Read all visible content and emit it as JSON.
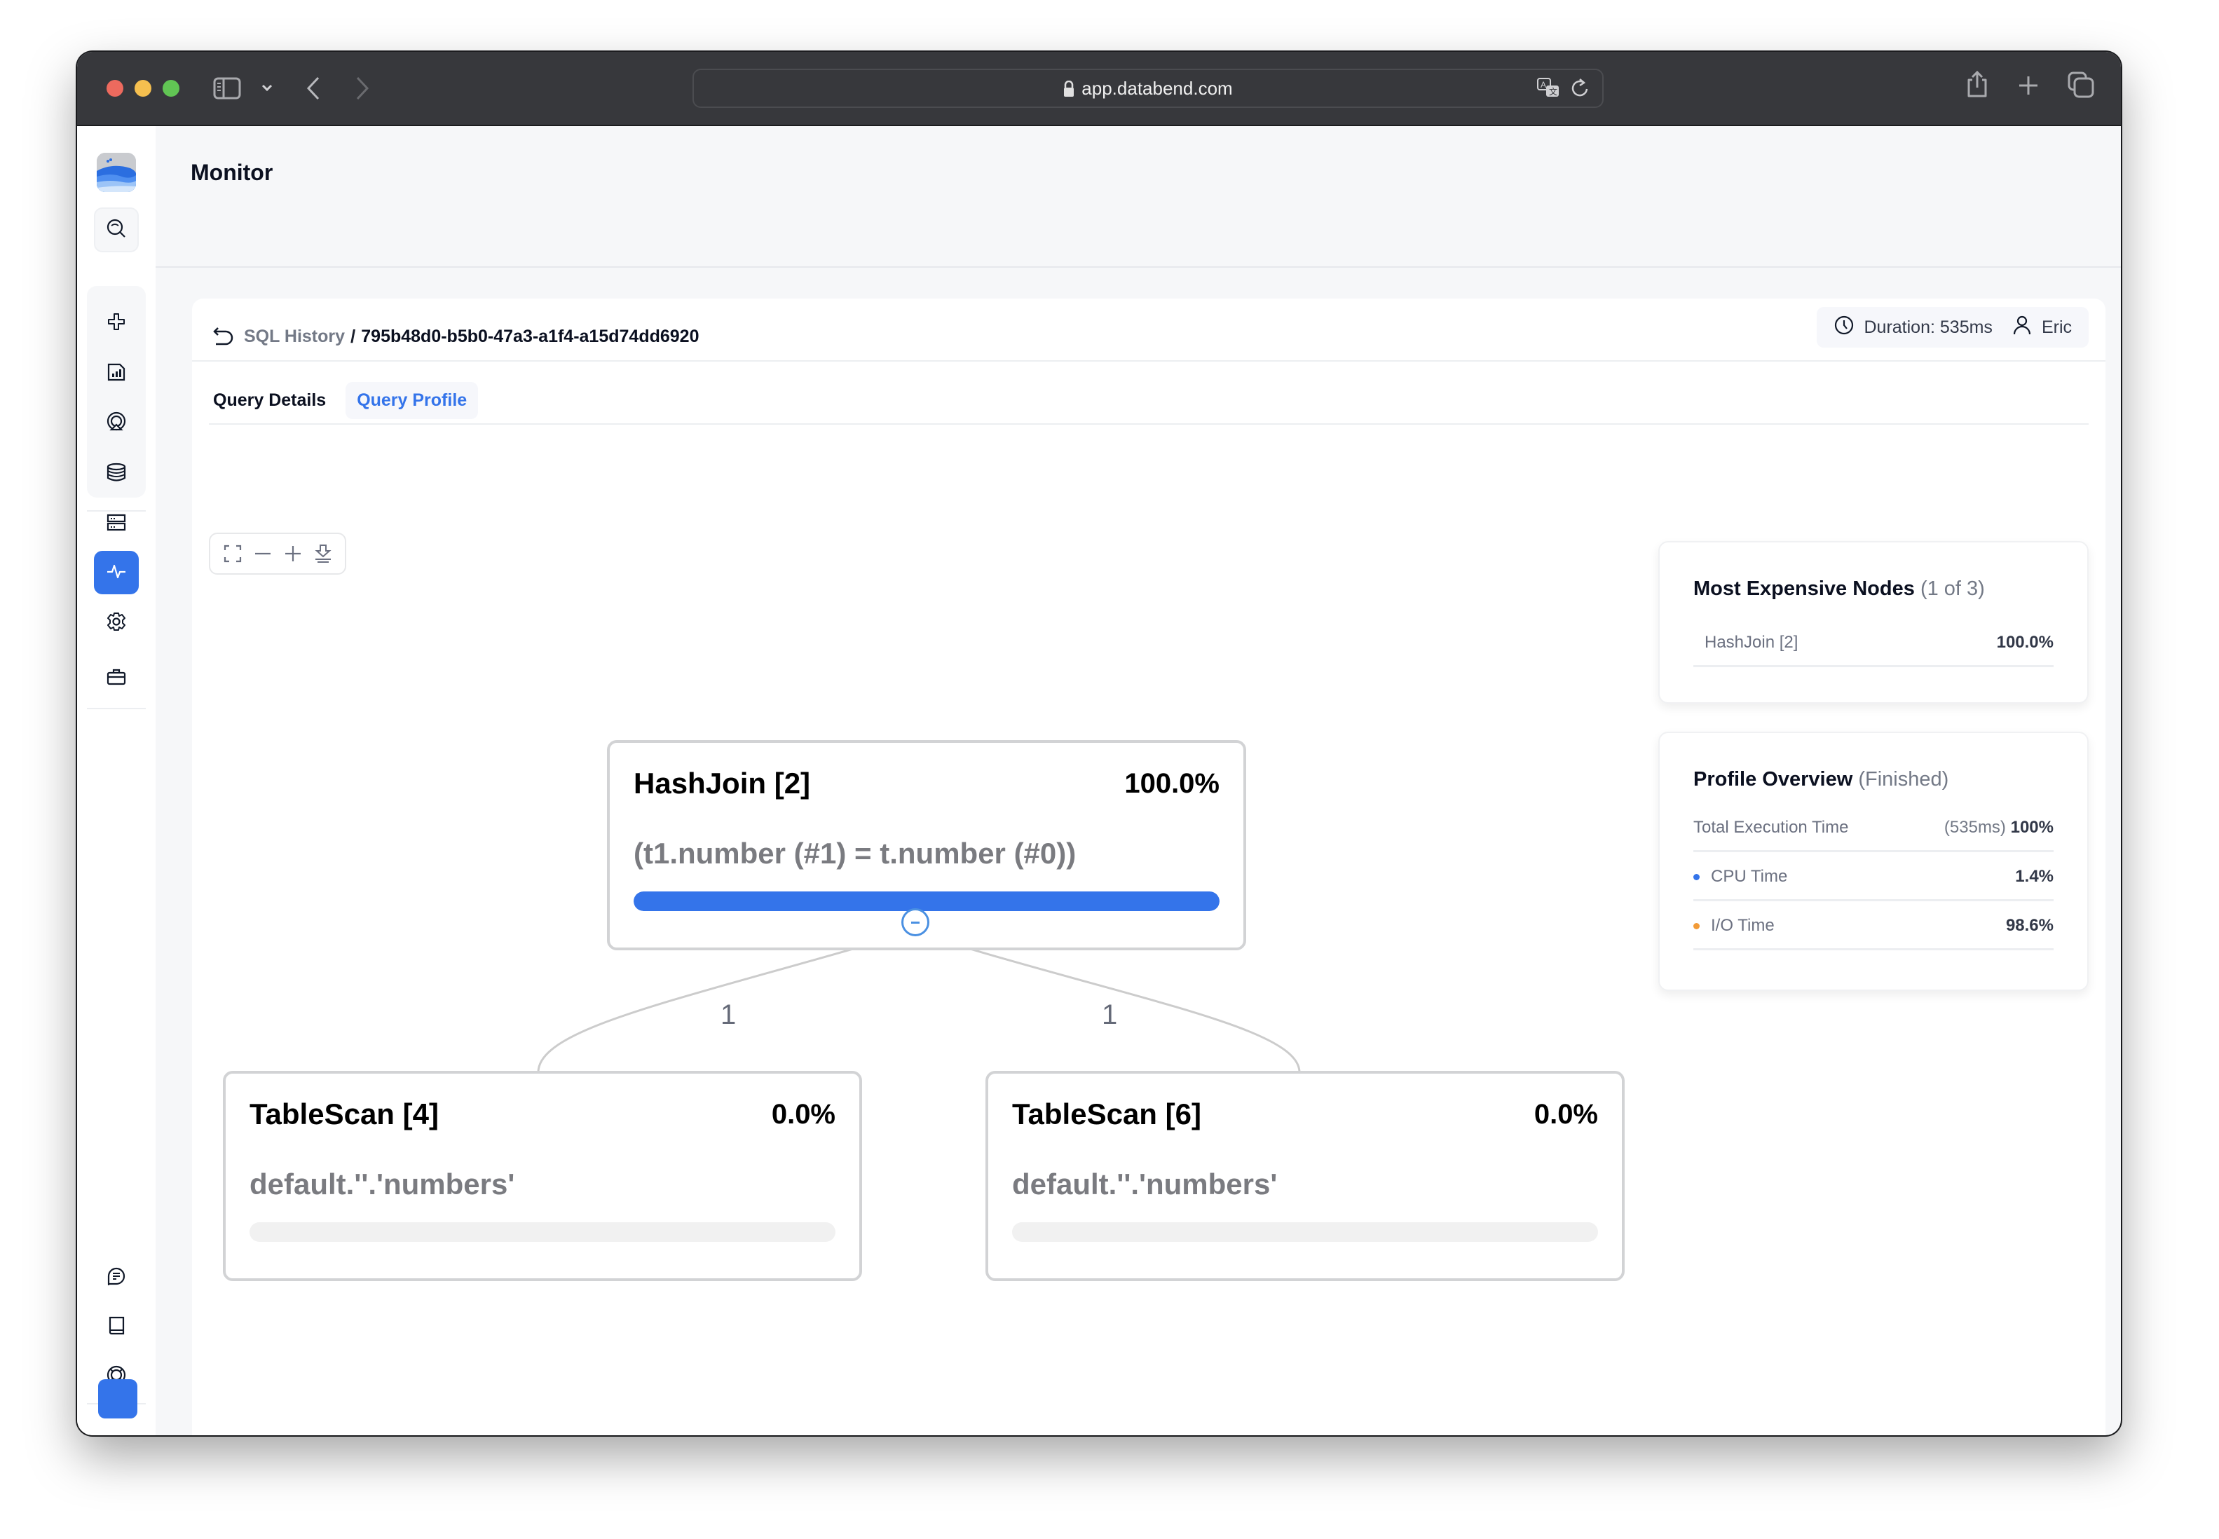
{
  "browser": {
    "url": "app.databend.com",
    "icons": [
      "sidebar-toggle-icon",
      "chevron-down-icon",
      "back-icon",
      "forward-icon",
      "lock-icon",
      "translate-icon",
      "reload-icon",
      "share-icon",
      "new-tab-icon",
      "tabs-overview-icon"
    ]
  },
  "sidebar": {
    "items": [
      {
        "name": "search",
        "icon": "search-icon"
      },
      {
        "name": "workspace",
        "icon": "workflow-icon"
      },
      {
        "name": "dashboards",
        "icon": "chart-icon"
      },
      {
        "name": "data-sharing",
        "icon": "broadcast-icon"
      },
      {
        "name": "databases",
        "icon": "database-icon"
      },
      {
        "name": "warehouses",
        "icon": "server-icon"
      },
      {
        "name": "monitor",
        "icon": "activity-icon",
        "active": true
      },
      {
        "name": "settings",
        "icon": "gear-icon"
      },
      {
        "name": "toolbox",
        "icon": "toolbox-icon"
      },
      {
        "name": "feedback",
        "icon": "chat-icon"
      },
      {
        "name": "docs",
        "icon": "book-icon"
      },
      {
        "name": "support",
        "icon": "lifebuoy-icon"
      }
    ],
    "accent": "#3474ea"
  },
  "page": {
    "title": "Monitor"
  },
  "breadcrumb": {
    "parent": "SQL History",
    "separator": "/",
    "current": "795b48d0-b5b0-47a3-a1f4-a15d74dd6920"
  },
  "meta": {
    "duration": "Duration: 535ms",
    "user": "Eric"
  },
  "tabs": [
    {
      "label": "Query Details",
      "active": false
    },
    {
      "label": "Query Profile",
      "active": true
    }
  ],
  "canvas_tools": [
    "fit-view",
    "zoom-out",
    "zoom-in",
    "download"
  ],
  "graph": {
    "nodes": [
      {
        "id": "hashjoin-2",
        "title": "HashJoin [2]",
        "percent": "100.0%",
        "fraction": 1.0,
        "description": "(t1.number (#1) = t.number (#0))"
      },
      {
        "id": "tablescan-4",
        "title": "TableScan [4]",
        "percent": "0.0%",
        "fraction": 0.0,
        "description": "default.''.'numbers'"
      },
      {
        "id": "tablescan-6",
        "title": "TableScan [6]",
        "percent": "0.0%",
        "fraction": 0.0,
        "description": "default.''.'numbers'"
      }
    ],
    "edges": [
      {
        "from": "tablescan-4",
        "to": "hashjoin-2",
        "label": "1"
      },
      {
        "from": "tablescan-6",
        "to": "hashjoin-2",
        "label": "1"
      }
    ]
  },
  "most_expensive": {
    "title": "Most Expensive Nodes",
    "count": "(1 of 3)",
    "rows": [
      {
        "name": "HashJoin [2]",
        "value": "100.0%"
      }
    ]
  },
  "profile_overview": {
    "title": "Profile Overview",
    "status": "(Finished)",
    "total_label": "Total Execution Time",
    "total_time": "(535ms)",
    "total_pct": "100%",
    "rows": [
      {
        "label": "CPU Time",
        "value": "1.4%",
        "color": "#3474ea"
      },
      {
        "label": "I/O Time",
        "value": "98.6%",
        "color": "#f29b38"
      }
    ]
  }
}
